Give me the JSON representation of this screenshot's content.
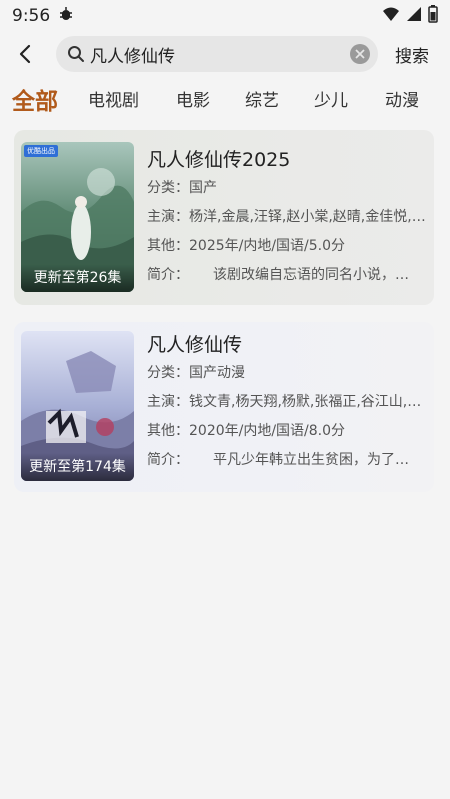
{
  "status_bar": {
    "time": "9:56",
    "notification_icon": "bug-icon",
    "icons": [
      "wifi-icon",
      "signal-icon",
      "battery-icon"
    ]
  },
  "search": {
    "query": "凡人修仙传",
    "action_label": "搜索"
  },
  "tabs": [
    {
      "label": "全部",
      "active": true
    },
    {
      "label": "电视剧",
      "active": false
    },
    {
      "label": "电影",
      "active": false
    },
    {
      "label": "综艺",
      "active": false
    },
    {
      "label": "少儿",
      "active": false
    },
    {
      "label": "动漫",
      "active": false
    }
  ],
  "results": [
    {
      "title": "凡人修仙传2025",
      "poster_update": "更新至第26集",
      "poster_badge": "优酷出品",
      "category_label": "分类：",
      "category": "国产",
      "cast_label": "主演：",
      "cast": "杨洋,金晨,汪铎,赵小棠,赵晴,金佳悦,…",
      "other_label": "其他：",
      "other": "2025年/内地/国语/5.0分",
      "intro_label": "简介：",
      "intro": "该剧改编自忘语的同名小说，…"
    },
    {
      "title": "凡人修仙传",
      "poster_update": "更新至第174集",
      "category_label": "分类：",
      "category": "国产动漫",
      "cast_label": "主演：",
      "cast": "钱文青,杨天翔,杨默,张福正,谷江山,…",
      "other_label": "其他：",
      "other": "2020年/内地/国语/8.0分",
      "intro_label": "简介：",
      "intro": "平凡少年韩立出生贫困，为了…"
    }
  ]
}
